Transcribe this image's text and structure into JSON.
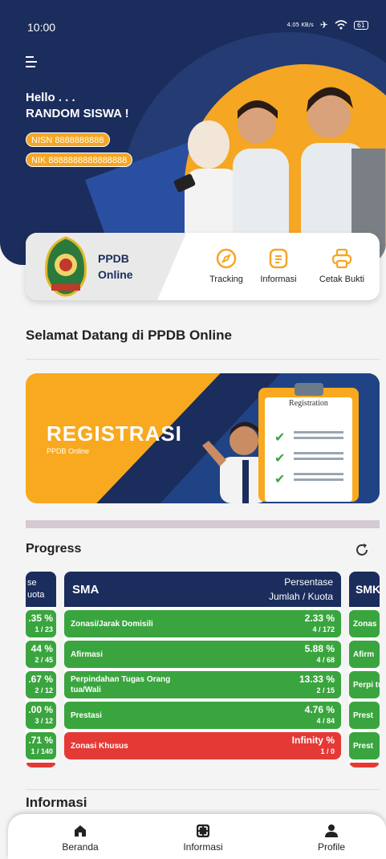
{
  "status_bar": {
    "time": "10:00",
    "net_speed": "4.05 KB/s",
    "battery": "61"
  },
  "hero": {
    "greeting": "Hello . . .",
    "name": "RANDOM SISWA !",
    "nisn": "NISN 8888888888",
    "nik": "NIK 8888888888888888"
  },
  "app_card": {
    "title_line1": "PPDB",
    "title_line2": "Online",
    "actions": [
      {
        "label": "Tracking",
        "icon": "compass-icon"
      },
      {
        "label": "Informasi",
        "icon": "document-icon"
      },
      {
        "label": "Cetak Bukti",
        "icon": "printer-icon"
      }
    ]
  },
  "welcome": "Selamat Datang di PPDB Online",
  "banner": {
    "title": "REGISTRASI",
    "subtitle": "PPDB Online",
    "clipboard_title": "Registration"
  },
  "progress": {
    "title": "Progress",
    "left_table": {
      "header_l1": "se",
      "header_l2": "uota",
      "rows": [
        {
          "pct": ".35 %",
          "quota": "1 / 23",
          "color": "green"
        },
        {
          "pct": "44 %",
          "quota": "2 / 45",
          "color": "green"
        },
        {
          "pct": ".67 %",
          "quota": "2 / 12",
          "color": "green"
        },
        {
          "pct": ".00 %",
          "quota": "3 / 12",
          "color": "green"
        },
        {
          "pct": ".71 %",
          "quota": "1 / 140",
          "color": "green"
        }
      ]
    },
    "main_table": {
      "school": "SMA",
      "header_pct": "Persentase",
      "header_quota": "Jumlah / Kuota",
      "rows": [
        {
          "name": "Zonasi/Jarak Domisili",
          "pct": "2.33 %",
          "quota": "4 / 172",
          "color": "green"
        },
        {
          "name": "Afirmasi",
          "pct": "5.88 %",
          "quota": "4 / 68",
          "color": "green"
        },
        {
          "name": "Perpindahan Tugas Orang tua/Wali",
          "pct": "13.33 %",
          "quota": "2 / 15",
          "color": "green"
        },
        {
          "name": "Prestasi",
          "pct": "4.76 %",
          "quota": "4 / 84",
          "color": "green"
        },
        {
          "name": "Zonasi Khusus",
          "pct": "Infinity %",
          "quota": "1 / 0",
          "color": "red"
        }
      ]
    },
    "right_table": {
      "school": "SMK",
      "rows": [
        {
          "name": "Zonas"
        },
        {
          "name": "Afirm"
        },
        {
          "name": "Perpi tua/W"
        },
        {
          "name": "Prest"
        },
        {
          "name": "Prest"
        }
      ]
    }
  },
  "info_title": "Informasi",
  "bottom_nav": [
    {
      "label": "Beranda",
      "icon": "home-icon"
    },
    {
      "label": "Informasi",
      "icon": "expand-icon"
    },
    {
      "label": "Profile",
      "icon": "person-icon"
    }
  ],
  "colors": {
    "navy": "#1b2d5c",
    "orange": "#f5a623",
    "green": "#3aa53f",
    "red": "#e53935"
  }
}
